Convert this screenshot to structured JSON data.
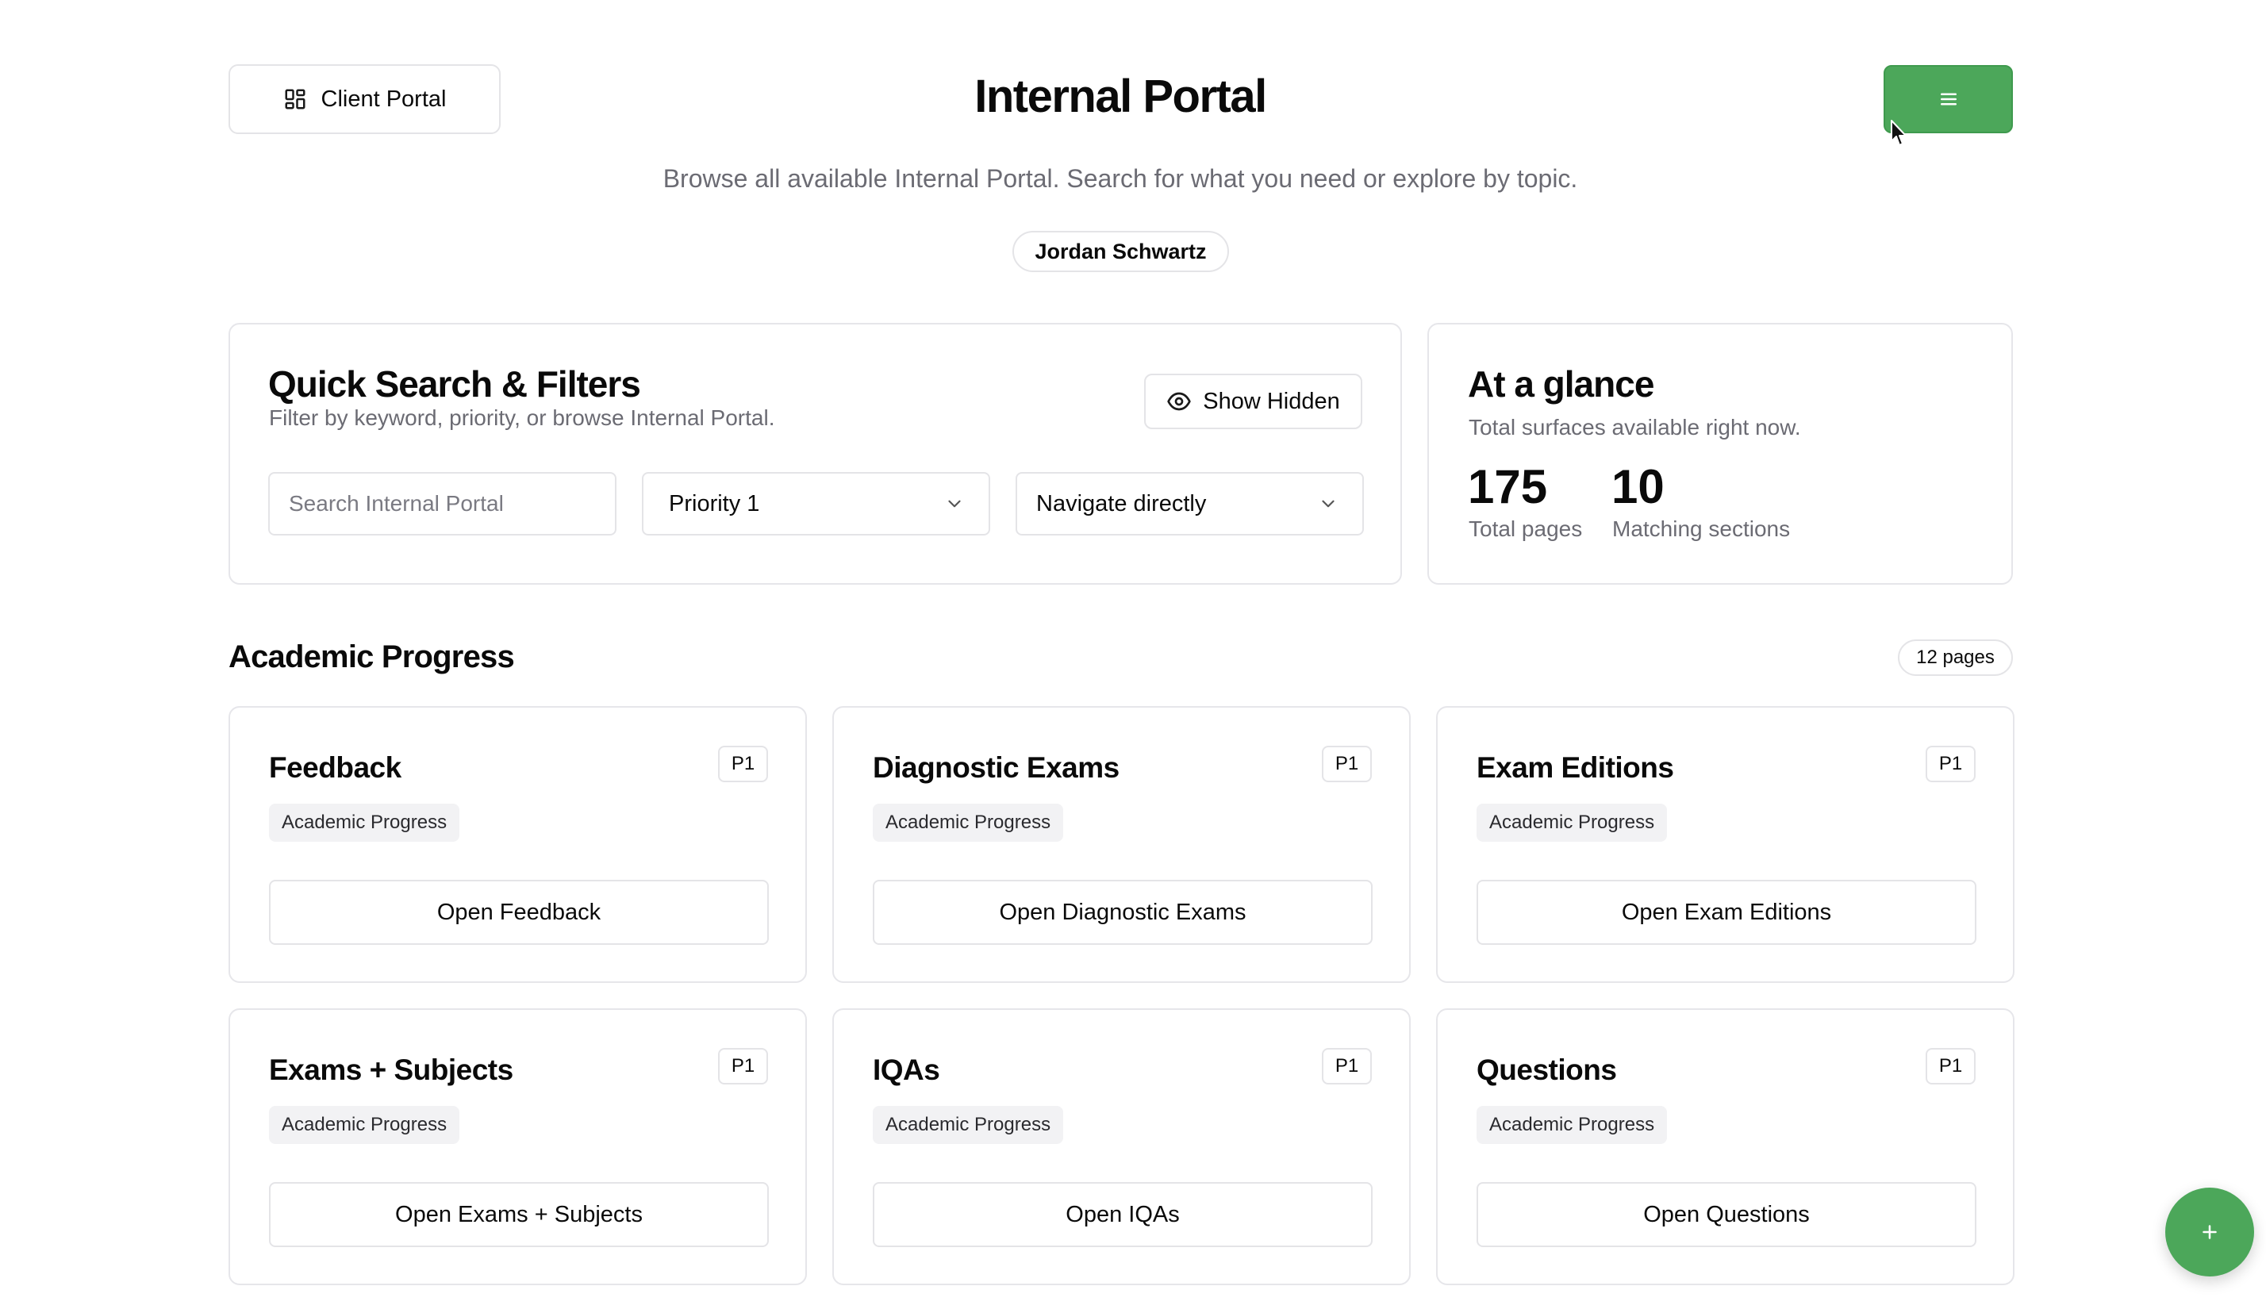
{
  "header": {
    "client_portal_label": "Client Portal",
    "title": "Internal Portal",
    "subtitle": "Browse all available Internal Portal. Search for what you need or explore by topic.",
    "user_name": "Jordan Schwartz"
  },
  "filters": {
    "title": "Quick Search & Filters",
    "description": "Filter by keyword, priority, or browse Internal Portal.",
    "show_hidden_label": "Show Hidden",
    "search_placeholder": "Search Internal Portal",
    "search_value": "",
    "priority_selected": "Priority 1",
    "navigate_selected": "Navigate directly"
  },
  "glance": {
    "title": "At a glance",
    "description": "Total surfaces available right now.",
    "stats": [
      {
        "value": "175",
        "label": "Total pages"
      },
      {
        "value": "10",
        "label": "Matching sections"
      }
    ]
  },
  "section": {
    "title": "Academic Progress",
    "count_label": "12 pages",
    "cards": [
      {
        "title": "Feedback",
        "badge": "P1",
        "tag": "Academic Progress",
        "action": "Open Feedback"
      },
      {
        "title": "Diagnostic Exams",
        "badge": "P1",
        "tag": "Academic Progress",
        "action": "Open Diagnostic Exams"
      },
      {
        "title": "Exam Editions",
        "badge": "P1",
        "tag": "Academic Progress",
        "action": "Open Exam Editions"
      },
      {
        "title": "Exams + Subjects",
        "badge": "P1",
        "tag": "Academic Progress",
        "action": "Open Exams + Subjects"
      },
      {
        "title": "IQAs",
        "badge": "P1",
        "tag": "Academic Progress",
        "action": "Open IQAs"
      },
      {
        "title": "Questions",
        "badge": "P1",
        "tag": "Academic Progress",
        "action": "Open Questions"
      }
    ]
  },
  "icons": {
    "client_portal": "grid-icon",
    "menu": "hamburger-menu-icon",
    "show_hidden": "eye-icon",
    "select": "chevron-down-icon",
    "fab": "plus-icon"
  },
  "colors": {
    "accent": "#4ca75a",
    "text": "#0a0a0a",
    "muted": "#6b6b73",
    "border": "#e4e4e7",
    "tag_bg": "#f2f2f4"
  }
}
